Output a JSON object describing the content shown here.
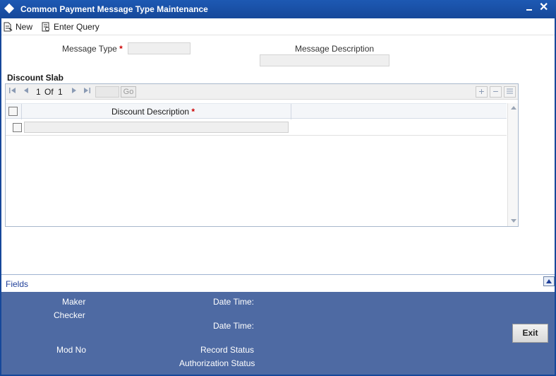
{
  "window": {
    "title": "Common Payment Message Type Maintenance",
    "close_glyph": "✕"
  },
  "toolbar": {
    "new_label": "New",
    "enter_query_label": "Enter Query"
  },
  "form": {
    "message_type_label": "Message Type",
    "message_type_value": "",
    "message_description_label": "Message Description",
    "message_description_value": "",
    "required_mark": "*"
  },
  "discount_slab": {
    "title": "Discount Slab",
    "pager": {
      "current": "1",
      "of_label": "Of",
      "total": "1",
      "go_label": "Go",
      "page_input": ""
    },
    "columns": [
      {
        "label": "Discount Description",
        "required": "*"
      }
    ],
    "rows": [
      {
        "discount_description": ""
      }
    ]
  },
  "fields_link": "Fields",
  "audit": {
    "maker_label": "Maker",
    "checker_label": "Checker",
    "date_time_label": "Date Time:",
    "mod_no_label": "Mod No",
    "record_status_label": "Record Status",
    "authorization_status_label": "Authorization Status"
  },
  "exit_label": "Exit",
  "colors": {
    "title_bar": "#16489a",
    "footer": "#4e6aa3",
    "required": "#cc0000",
    "link": "#1f3f99"
  }
}
